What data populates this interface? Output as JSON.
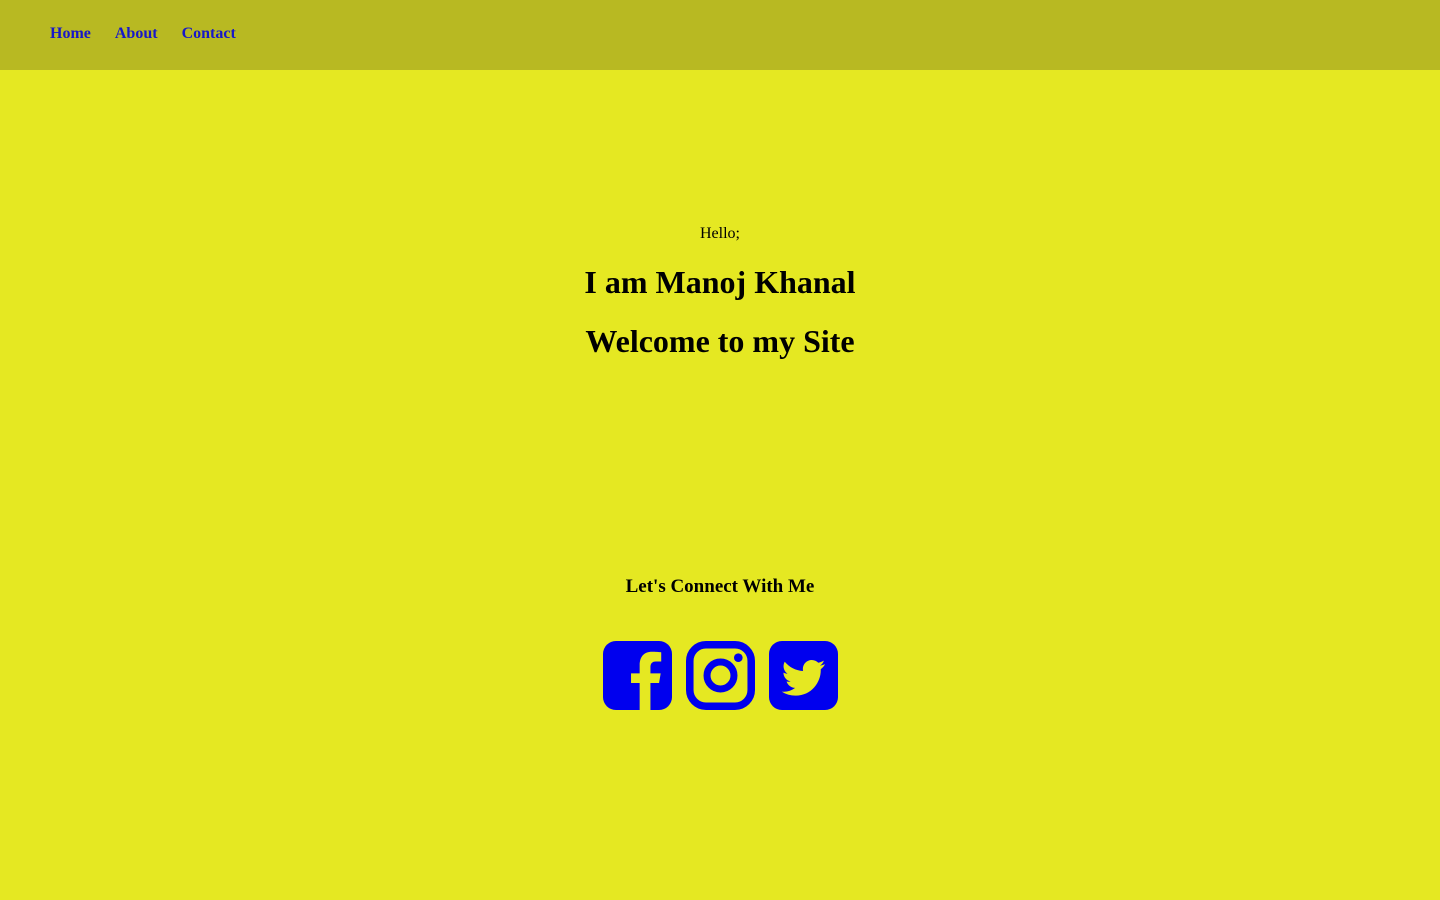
{
  "nav": {
    "items": [
      {
        "label": "Home"
      },
      {
        "label": "About"
      },
      {
        "label": "Contact"
      }
    ]
  },
  "hero": {
    "greeting": "Hello;",
    "title": "I am Manoj Khanal",
    "subtitle": "Welcome to my Site"
  },
  "connect": {
    "heading": "Let's Connect With Me",
    "icons": [
      "facebook-icon",
      "instagram-icon",
      "twitter-icon"
    ]
  },
  "colors": {
    "background": "#e5e822",
    "navbar": "#b8b922",
    "link": "#1717c9",
    "icon": "#0000ee"
  }
}
